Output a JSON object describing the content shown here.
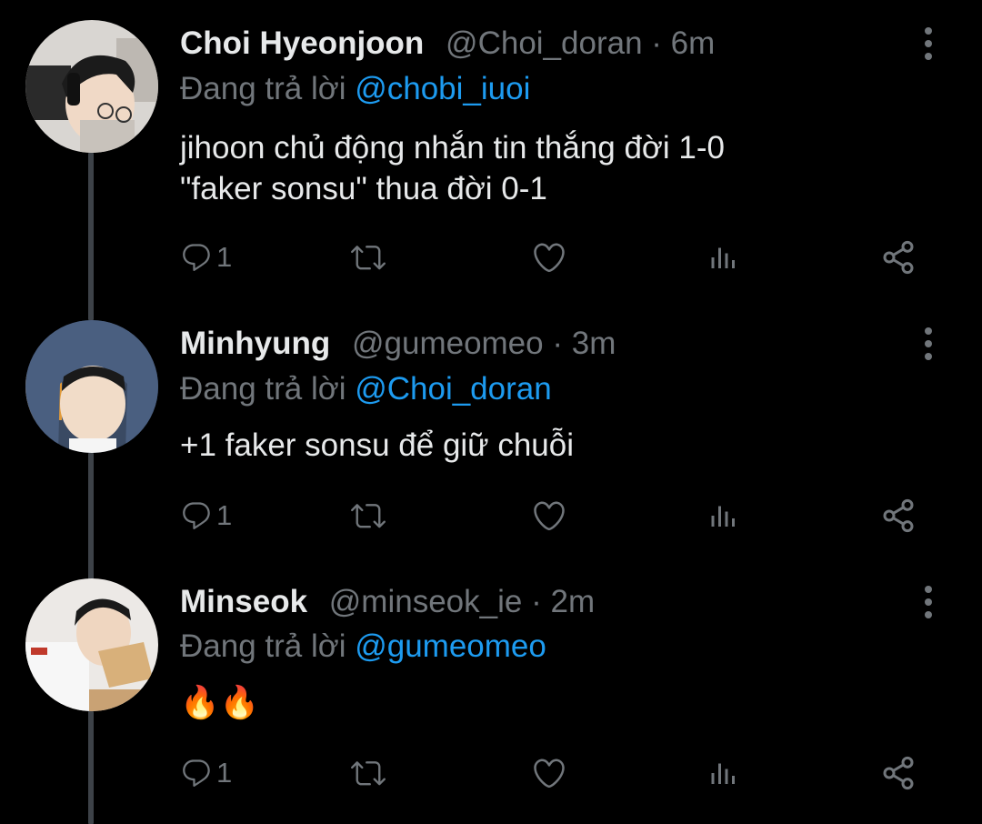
{
  "colors": {
    "background": "#000000",
    "primary_text": "#e7e9ea",
    "secondary_text": "#71767b",
    "mention": "#1d9bf0",
    "thread_line": "#3d4248"
  },
  "tweets": [
    {
      "name": "Choi Hyeonjoon",
      "handle": "@Choi_doran",
      "separator": "·",
      "time": "6m",
      "replying_prefix": "Đang trả lời ",
      "replying_to": "@chobi_iuoi",
      "text": "jihoon chủ động nhắn tin thắng đời 1-0\n\"faker sonsu\" thua đời 0-1",
      "reply_count": "1"
    },
    {
      "name": "Minhyung",
      "handle": "@gumeomeo",
      "separator": "·",
      "time": "3m",
      "replying_prefix": "Đang trả lời ",
      "replying_to": "@Choi_doran",
      "text": "+1 faker sonsu để giữ chuỗi",
      "reply_count": "1"
    },
    {
      "name": "Minseok",
      "handle": "@minseok_ie",
      "separator": "·",
      "time": "2m",
      "replying_prefix": "Đang trả lời ",
      "replying_to": "@gumeomeo",
      "text": "🔥🔥",
      "reply_count": "1"
    }
  ],
  "icons": [
    "reply-icon",
    "retweet-icon",
    "like-icon",
    "analytics-icon",
    "share-icon",
    "more-options-icon"
  ]
}
